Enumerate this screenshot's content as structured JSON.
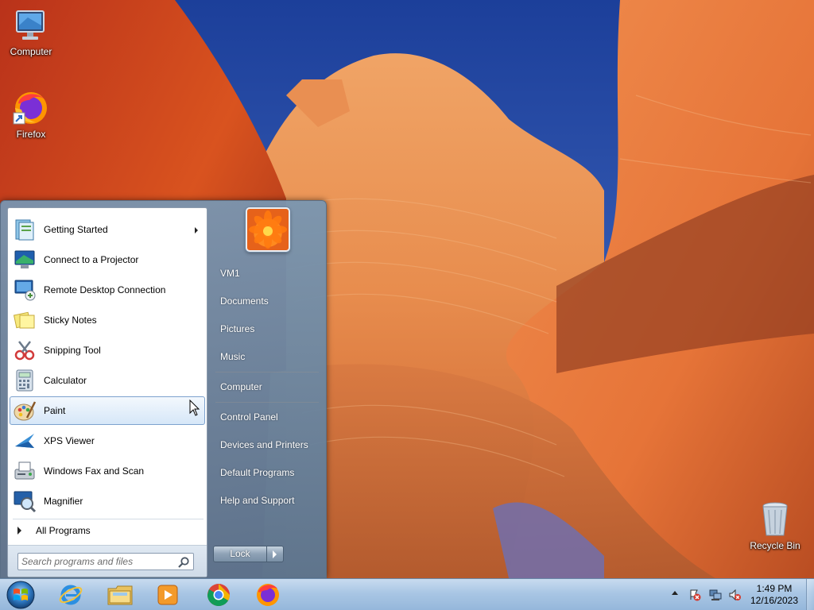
{
  "desktop": {
    "icons": [
      {
        "label": "Computer",
        "icon": "computer-icon"
      },
      {
        "label": "Firefox",
        "icon": "firefox-icon"
      },
      {
        "label": "Recycle Bin",
        "icon": "recycle-bin-icon"
      }
    ]
  },
  "start_menu": {
    "programs": [
      {
        "label": "Getting Started",
        "icon": "getting-started-icon",
        "has_submenu": true
      },
      {
        "label": "Connect to a Projector",
        "icon": "projector-icon"
      },
      {
        "label": "Remote Desktop Connection",
        "icon": "remote-desktop-icon"
      },
      {
        "label": "Sticky Notes",
        "icon": "sticky-notes-icon"
      },
      {
        "label": "Snipping Tool",
        "icon": "snipping-tool-icon"
      },
      {
        "label": "Calculator",
        "icon": "calculator-icon"
      },
      {
        "label": "Paint",
        "icon": "paint-icon",
        "highlighted": true
      },
      {
        "label": "XPS Viewer",
        "icon": "xps-viewer-icon"
      },
      {
        "label": "Windows Fax and Scan",
        "icon": "fax-scan-icon"
      },
      {
        "label": "Magnifier",
        "icon": "magnifier-icon"
      }
    ],
    "all_programs": "All Programs",
    "search": {
      "placeholder": "Search programs and files"
    },
    "places": [
      "VM1",
      "Documents",
      "Pictures",
      "Music",
      "Computer",
      "Control Panel",
      "Devices and Printers",
      "Default Programs",
      "Help and Support"
    ],
    "lock_label": "Lock"
  },
  "taskbar": {
    "pinned": [
      {
        "icon": "internet-explorer-icon"
      },
      {
        "icon": "file-explorer-icon"
      },
      {
        "icon": "media-player-icon"
      },
      {
        "icon": "chrome-icon"
      },
      {
        "icon": "firefox-icon"
      }
    ],
    "tray_icons": [
      "action-center-icon",
      "network-icon",
      "volume-muted-icon"
    ],
    "clock": {
      "time": "1:49 PM",
      "date": "12/16/2023"
    }
  },
  "colors": {
    "start_menu_right": "#6f8aa5",
    "highlight": "#d6e7f8",
    "taskbar": "#a9c6e4"
  }
}
